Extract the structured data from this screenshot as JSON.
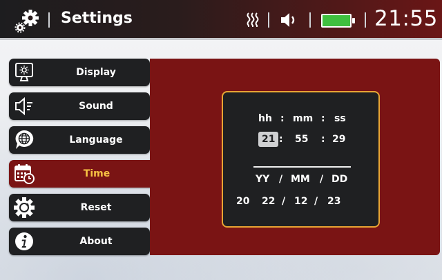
{
  "header": {
    "title": "Settings",
    "time": "21:55",
    "icons": [
      "gear-icon",
      "signal-icon",
      "speaker-icon",
      "battery-icon"
    ],
    "battery_color": "#3fbf3f"
  },
  "sidebar": {
    "items": [
      {
        "label": "Display",
        "icon": "display-icon"
      },
      {
        "label": "Sound",
        "icon": "sound-icon"
      },
      {
        "label": "Language",
        "icon": "language-icon"
      },
      {
        "label": "Time",
        "icon": "calendar-clock-icon",
        "active": true
      },
      {
        "label": "Reset",
        "icon": "reset-icon"
      },
      {
        "label": "About",
        "icon": "info-icon"
      }
    ]
  },
  "time_panel": {
    "time_headers": {
      "hh": "hh",
      "mm": "mm",
      "ss": "ss",
      "sep": ":"
    },
    "time_values": {
      "hour": "21",
      "minute": "55",
      "second": "29"
    },
    "date_headers": {
      "yy": "YY",
      "mm": "MM",
      "dd": "DD",
      "sep": "/"
    },
    "date_values": {
      "century": "20",
      "year": "22",
      "month": "12",
      "day": "23"
    }
  },
  "colors": {
    "accent": "#7a1414",
    "active_label": "#f7c243",
    "card_border": "#e8a534"
  }
}
